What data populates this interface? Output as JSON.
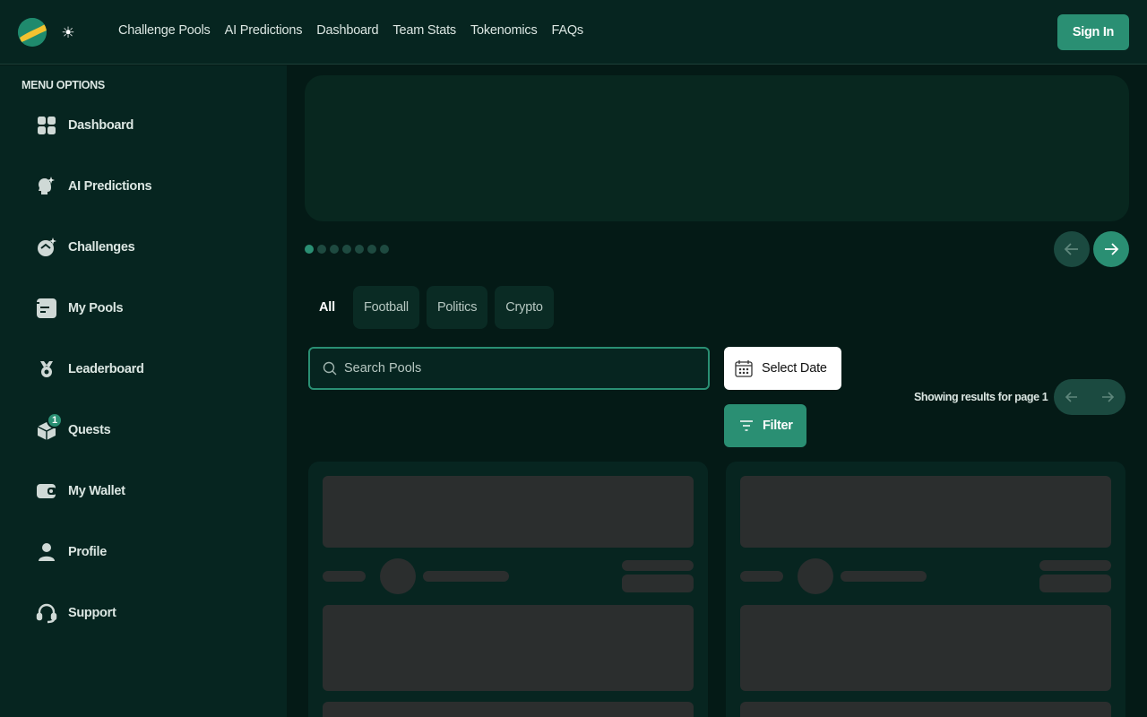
{
  "header": {
    "logo_icon": "planet-logo-icon",
    "theme_icon": "sun-icon",
    "nav": [
      "Challenge Pools",
      "AI Predictions",
      "Dashboard",
      "Team Stats",
      "Tokenomics",
      "FAQs"
    ],
    "sign_in_label": "Sign In"
  },
  "sidebar": {
    "title": "MENU OPTIONS",
    "items": [
      {
        "label": "Dashboard",
        "icon": "grid-icon"
      },
      {
        "label": "AI Predictions",
        "icon": "ai-head-icon"
      },
      {
        "label": "Challenges",
        "icon": "challenge-icon"
      },
      {
        "label": "My Pools",
        "icon": "pools-icon"
      },
      {
        "label": "Leaderboard",
        "icon": "medal-icon"
      },
      {
        "label": "Quests",
        "icon": "box-icon",
        "badge": "1"
      },
      {
        "label": "My Wallet",
        "icon": "wallet-icon"
      },
      {
        "label": "Profile",
        "icon": "user-icon"
      },
      {
        "label": "Support",
        "icon": "headset-icon"
      }
    ]
  },
  "carousel": {
    "slide_count": 7,
    "active_index": 0
  },
  "tabs": [
    "All",
    "Football",
    "Politics",
    "Crypto"
  ],
  "active_tab": "All",
  "search": {
    "placeholder": "Search Pools"
  },
  "date_button_label": "Select Date",
  "filter_button_label": "Filter",
  "results_text": "Showing results for page 1",
  "colors": {
    "accent": "#2a8f73",
    "background": "#041a16",
    "panel": "#062520",
    "skeleton": "#2b2e2e"
  }
}
